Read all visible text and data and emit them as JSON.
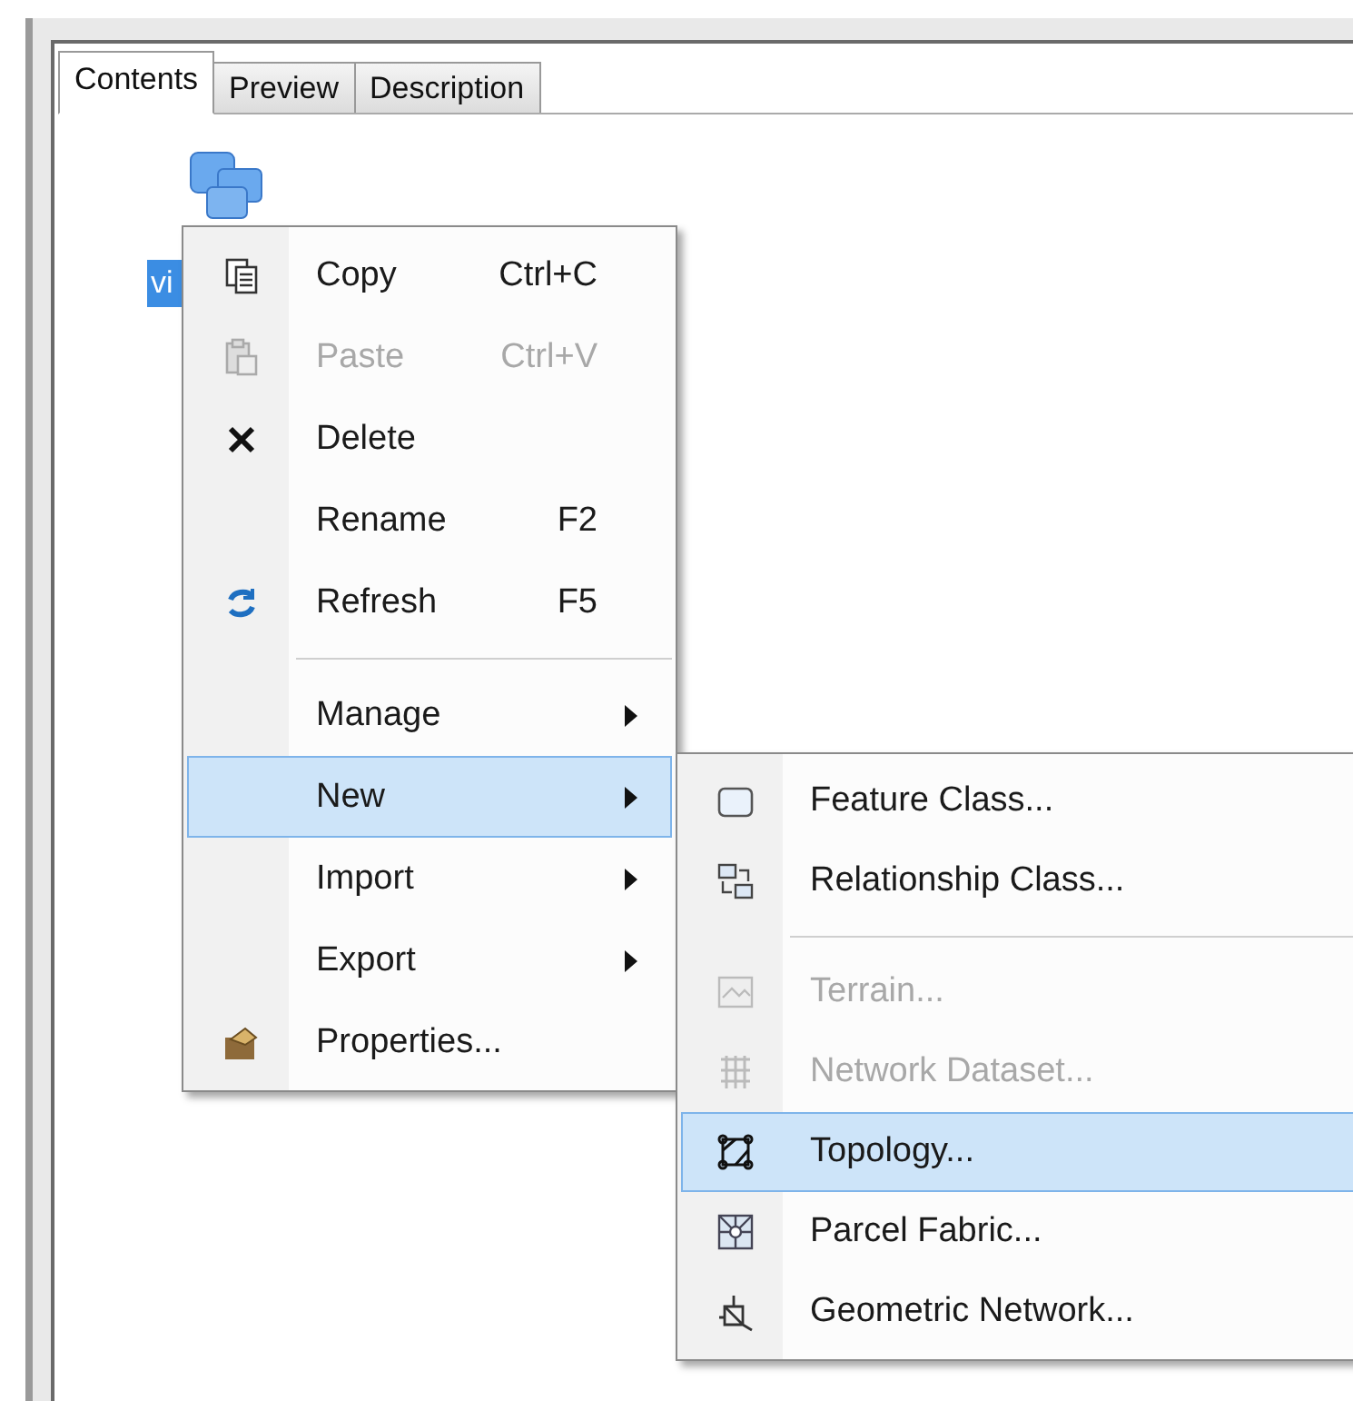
{
  "tabs": [
    {
      "label": "Contents",
      "selected": true
    },
    {
      "label": "Preview",
      "selected": false
    },
    {
      "label": "Description",
      "selected": false
    }
  ],
  "tree": {
    "label": "vi",
    "selected": true
  },
  "context_menu": [
    {
      "kind": "item",
      "label": "Copy",
      "shortcut": "Ctrl+C",
      "disabled": false,
      "selected": false
    },
    {
      "kind": "item",
      "label": "Paste",
      "shortcut": "Ctrl+V",
      "disabled": true,
      "selected": false
    },
    {
      "kind": "item",
      "label": "Delete",
      "disabled": false,
      "selected": false
    },
    {
      "kind": "item",
      "label": "Rename",
      "shortcut": "F2",
      "disabled": false,
      "selected": false
    },
    {
      "kind": "item",
      "label": "Refresh",
      "shortcut": "F5",
      "disabled": false,
      "selected": false
    },
    {
      "kind": "separator"
    },
    {
      "kind": "item",
      "label": "Manage",
      "submenu": true,
      "disabled": false,
      "selected": false
    },
    {
      "kind": "item",
      "label": "New",
      "submenu": true,
      "disabled": false,
      "selected": true
    },
    {
      "kind": "item",
      "label": "Import",
      "submenu": true,
      "disabled": false,
      "selected": false
    },
    {
      "kind": "item",
      "label": "Export",
      "submenu": true,
      "disabled": false,
      "selected": false
    },
    {
      "kind": "item",
      "label": "Properties...",
      "disabled": false,
      "selected": false
    }
  ],
  "new_submenu": [
    {
      "kind": "item",
      "label": "Feature Class...",
      "disabled": false,
      "selected": false
    },
    {
      "kind": "item",
      "label": "Relationship Class...",
      "disabled": false,
      "selected": false
    },
    {
      "kind": "separator"
    },
    {
      "kind": "item",
      "label": "Terrain...",
      "disabled": true,
      "selected": false
    },
    {
      "kind": "item",
      "label": "Network Dataset...",
      "disabled": true,
      "selected": false
    },
    {
      "kind": "item",
      "label": "Topology...",
      "disabled": false,
      "selected": true
    },
    {
      "kind": "item",
      "label": "Parcel Fabric...",
      "disabled": false,
      "selected": false
    },
    {
      "kind": "item",
      "label": "Geometric Network...",
      "disabled": false,
      "selected": false
    }
  ]
}
